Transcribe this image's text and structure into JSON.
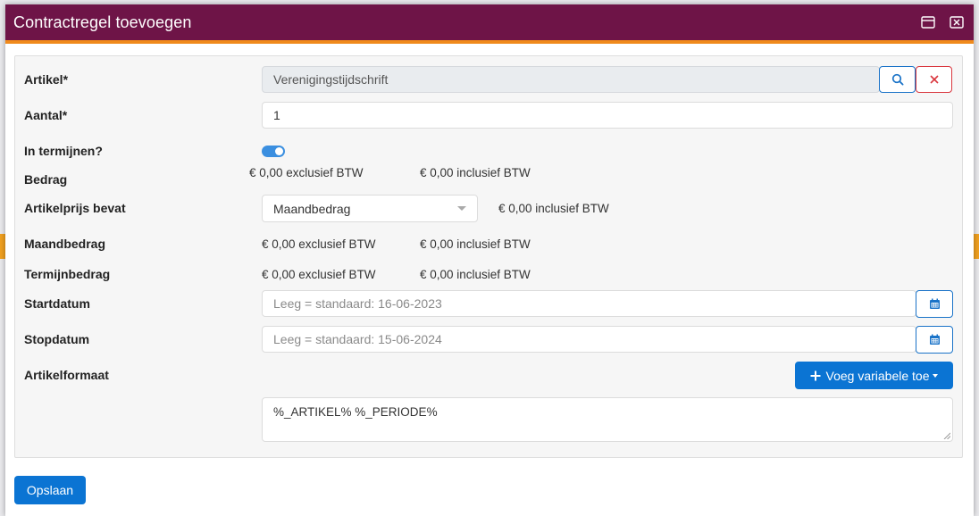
{
  "modal": {
    "title": "Contractregel toevoegen"
  },
  "fields": {
    "artikel": {
      "label": "Artikel*",
      "value": "Verenigingstijdschrift"
    },
    "aantal": {
      "label": "Aantal*",
      "value": "1"
    },
    "termijnen": {
      "label": "In termijnen?",
      "on": true
    },
    "bedrag": {
      "label": "Bedrag",
      "excl": "€ 0,00 exclusief BTW",
      "incl": "€ 0,00 inclusief BTW"
    },
    "artikelprijs": {
      "label": "Artikelprijs bevat",
      "selected": "Maandbedrag",
      "incl": "€ 0,00 inclusief BTW"
    },
    "maandbedrag": {
      "label": "Maandbedrag",
      "excl": "€ 0,00 exclusief BTW",
      "incl": "€ 0,00 inclusief BTW"
    },
    "termijnbedrag": {
      "label": "Termijnbedrag",
      "excl": "€ 0,00 exclusief BTW",
      "incl": "€ 0,00 inclusief BTW"
    },
    "startdatum": {
      "label": "Startdatum",
      "placeholder": "Leeg = standaard: 16-06-2023"
    },
    "stopdatum": {
      "label": "Stopdatum",
      "placeholder": "Leeg = standaard: 15-06-2024"
    },
    "artikelformaat": {
      "label": "Artikelformaat",
      "button": "Voeg variabele toe",
      "value": "%_ARTIKEL% %_PERIODE%"
    }
  },
  "footer": {
    "save": "Opslaan"
  },
  "colors": {
    "header": "#6e1447",
    "accent": "#f08a1c",
    "primary": "#0b74d3",
    "danger": "#d9363e"
  },
  "icons": [
    "window-icon",
    "close-window-icon",
    "search-icon",
    "clear-icon",
    "calendar-icon",
    "plus-icon",
    "caret-down-icon"
  ]
}
